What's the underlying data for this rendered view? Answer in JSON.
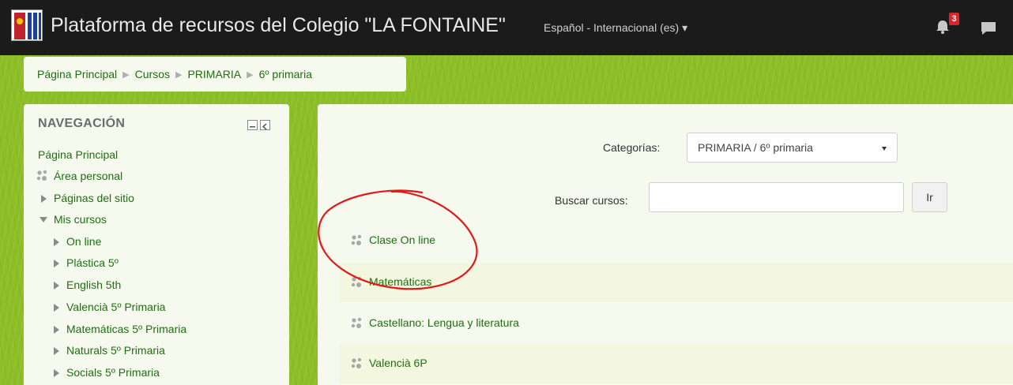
{
  "header": {
    "site_title": "Plataforma de recursos del Colegio \"LA FONTAINE\"",
    "language": "Español - Internacional (es) ▾",
    "notification_count": "3",
    "icons": [
      "logo",
      "bell-icon",
      "chat-icon"
    ]
  },
  "breadcrumb": {
    "items": [
      "Página Principal",
      "Cursos",
      "PRIMARIA",
      "6º primaria"
    ]
  },
  "navigation": {
    "title": "NAVEGACIÓN",
    "items": [
      "Página Principal",
      "Área personal",
      "Páginas del sitio",
      "Mis cursos",
      "On line",
      "Plástica 5º",
      "English 5th",
      "Valencià 5º Primaria",
      "Matemáticas 5º Primaria",
      "Naturals 5º Primaria",
      "Socials 5º Primaria"
    ]
  },
  "main": {
    "categories_label": "Categorías:",
    "categories_selected": "PRIMARIA / 6º primaria",
    "search_label": "Buscar cursos:",
    "search_value": "",
    "go_button": "Ir",
    "courses": [
      "Clase On line",
      "Matemáticas",
      "Castellano: Lengua y literatura",
      "Valencià 6P"
    ]
  },
  "colors": {
    "navbar": "#1b1b1b",
    "background_green": "#8cbf26",
    "panel": "#f5f9ee",
    "link_green": "#1f6f12",
    "annotation_red": "#e01a1a",
    "badge_red": "#d9232e"
  }
}
